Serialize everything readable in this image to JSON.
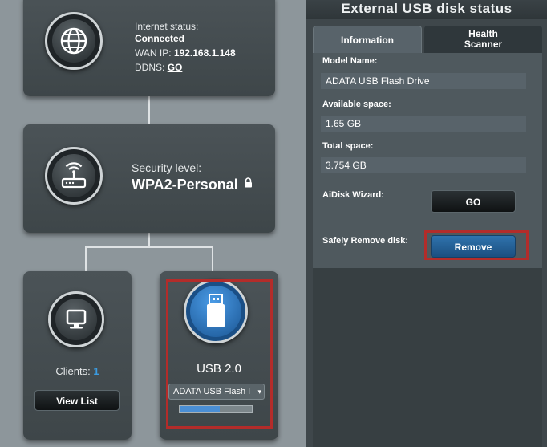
{
  "internet": {
    "status_label": "Internet status:",
    "status_value": "Connected",
    "wan_label": "WAN IP:",
    "wan_value": "192.168.1.148",
    "ddns_label": "DDNS:",
    "ddns_link": "GO"
  },
  "router": {
    "security_label": "Security level:",
    "security_value": "WPA2-Personal"
  },
  "clients": {
    "label": "Clients:",
    "count": "1",
    "view_list_label": "View List"
  },
  "usb": {
    "label": "USB 2.0",
    "device_select": "ADATA USB Flash I",
    "usage_fraction": 0.55
  },
  "panel": {
    "title": "External USB disk status",
    "tabs": {
      "information": "Information",
      "health_line1": "Health",
      "health_line2": "Scanner"
    },
    "model_label": "Model Name:",
    "model_value": "ADATA USB Flash Drive",
    "available_label": "Available space:",
    "available_value": "1.65 GB",
    "total_label": "Total space:",
    "total_value": "3.754 GB",
    "aidisk_label": "AiDisk Wizard:",
    "aidisk_button": "GO",
    "remove_label": "Safely Remove disk:",
    "remove_button": "Remove"
  },
  "colors": {
    "highlight_red": "#b32c2a",
    "remove_blue": "#2f73ad",
    "clients_count": "#3b9be0",
    "usage_bar": "#4a8fd6"
  }
}
